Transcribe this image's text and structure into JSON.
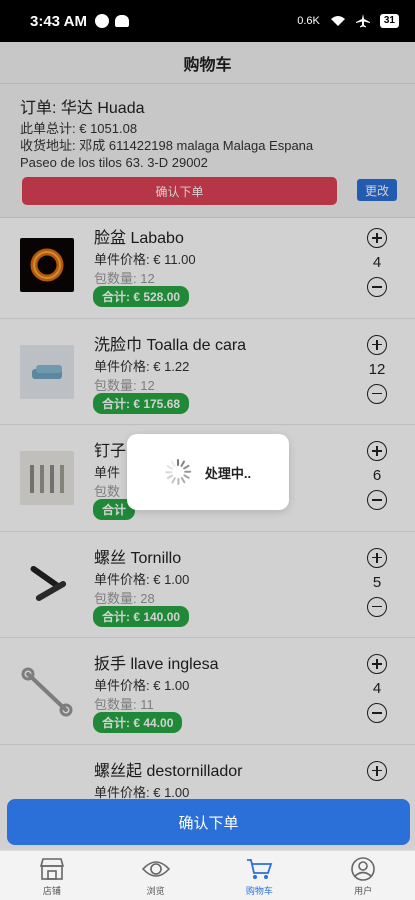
{
  "status_bar": {
    "time": "3:43 AM",
    "network_speed": "0.6K",
    "battery": "31"
  },
  "header": {
    "title": "购物车"
  },
  "order": {
    "title": "订单: 华达 Huada",
    "total": "此单总计: € 1051.08",
    "address": "收货地址: 邓成 611422198 malaga Malaga Espana Paseo de los tilos 63. 3-D 29002",
    "change_label": "更改",
    "confirm_label": "确认下单"
  },
  "items": [
    {
      "name": "脸盆 Lababo",
      "price": "单件价格: € 11.00",
      "pack": "包数量: 12",
      "total": "合计: € 528.00",
      "qty": "4"
    },
    {
      "name": "洗脸巾 Toalla de cara",
      "price": "单件价格: € 1.22",
      "pack": "包数量: 12",
      "total": "合计: € 175.68",
      "qty": "12"
    },
    {
      "name": "钉子",
      "price": "单件",
      "pack": "包数",
      "total": "合计",
      "qty": "6"
    },
    {
      "name": "螺丝 Tornillo",
      "price": "单件价格: € 1.00",
      "pack": "包数量: 28",
      "total": "合计: € 140.00",
      "qty": "5"
    },
    {
      "name": "扳手 llave inglesa",
      "price": "单件价格: € 1.00",
      "pack": "包数量: 11",
      "total": "合计: € 44.00",
      "qty": "4"
    },
    {
      "name": "螺丝起 destornillador",
      "price": "单件价格: € 1.00",
      "pack": "",
      "total": "",
      "qty": ""
    }
  ],
  "loading": {
    "text": "处理中.."
  },
  "bottom_confirm_label": "确认下单",
  "tabs": [
    {
      "label": "店铺",
      "icon": "store-icon"
    },
    {
      "label": "浏览",
      "icon": "eye-icon"
    },
    {
      "label": "购物车",
      "icon": "cart-icon",
      "active": true
    },
    {
      "label": "用户",
      "icon": "user-icon"
    }
  ],
  "colors": {
    "accent": "#2b6fd8",
    "confirm_red": "#e04356",
    "total_green": "#27a844"
  }
}
